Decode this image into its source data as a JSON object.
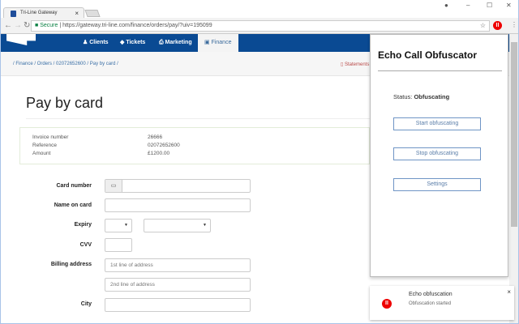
{
  "browser": {
    "tab_title": "Tri-Line Gateway",
    "secure_label": "Secure",
    "url": "https://gateway.tri-line.com/finance/orders/pay/?uiv=195099"
  },
  "nav": {
    "items": [
      {
        "label": "Clients",
        "icon": "user-icon"
      },
      {
        "label": "Tickets",
        "icon": "tag-icon"
      },
      {
        "label": "Marketing",
        "icon": "print-icon"
      },
      {
        "label": "Finance",
        "icon": "finance-icon"
      }
    ],
    "active": "Finance"
  },
  "breadcrumb": "/ Finance / Orders / 02072652600 / Pay by card /",
  "statements_label": "Statements",
  "page_title": "Pay by card",
  "invoice": {
    "rows": [
      {
        "label": "Invoice number",
        "value": "26666"
      },
      {
        "label": "Reference",
        "value": "02072652600"
      },
      {
        "label": "Amount",
        "value": "£1200.00"
      }
    ]
  },
  "form": {
    "card_number": "Card number",
    "name_on_card": "Name on card",
    "expiry": "Expiry",
    "cvv": "CVV",
    "billing_address": "Billing address",
    "address1_placeholder": "1st line of address",
    "address2_placeholder": "2nd line of address",
    "city": "City"
  },
  "popup": {
    "title": "Echo Call Obfuscator",
    "status_label": "Status:",
    "status_value": "Obfuscating",
    "start": "Start obfuscating",
    "stop": "Stop obfuscating",
    "settings": "Settings"
  },
  "notification": {
    "title": "Echo obfuscation",
    "message": "Obfuscation started"
  },
  "colors": {
    "nav": "#0a4a93",
    "extension": "#e00000"
  }
}
